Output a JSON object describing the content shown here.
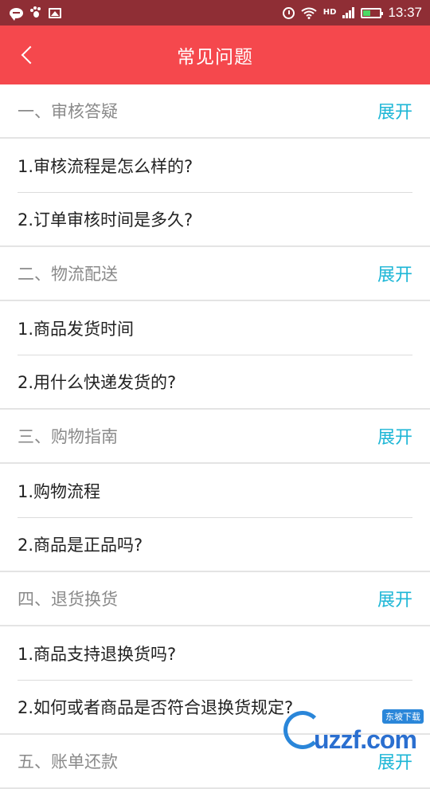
{
  "status_bar": {
    "time": "13:37",
    "network_label": "HD",
    "battery_level": 0.45
  },
  "header": {
    "title": "常见问题"
  },
  "sections": [
    {
      "title": "一、审核答疑",
      "expand_label": "展开",
      "questions": [
        "1.审核流程是怎么样的?",
        "2.订单审核时间是多久?"
      ]
    },
    {
      "title": "二、物流配送",
      "expand_label": "展开",
      "questions": [
        "1.商品发货时间",
        "2.用什么快递发货的?"
      ]
    },
    {
      "title": "三、购物指南",
      "expand_label": "展开",
      "questions": [
        "1.购物流程",
        "2.商品是正品吗?"
      ]
    },
    {
      "title": "四、退货换货",
      "expand_label": "展开",
      "questions": [
        "1.商品支持退换货吗?",
        "2.如何或者商品是否符合退换货规定?"
      ]
    },
    {
      "title": "五、账单还款",
      "expand_label": "展开",
      "questions": []
    }
  ],
  "watermark": {
    "text": "uzzf.com",
    "badge": "东坡下载"
  },
  "colors": {
    "status_bar": "#8f2e35",
    "header": "#f5484d",
    "accent": "#1cb6d6",
    "section_title": "#8a8a8a",
    "question_text": "#222222"
  }
}
